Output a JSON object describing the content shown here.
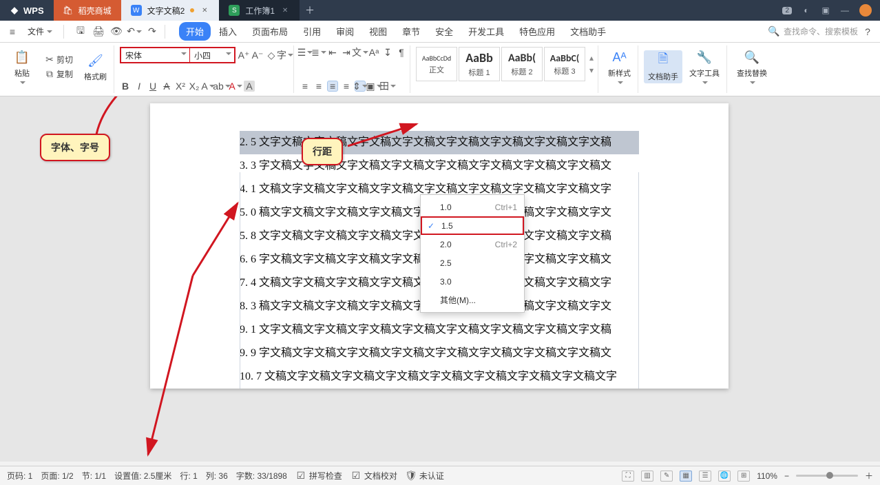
{
  "titlebar": {
    "app": "WPS",
    "tabs": [
      {
        "label": "稻壳商城",
        "kind": "store"
      },
      {
        "label": "文字文稿2",
        "kind": "doc",
        "active": true,
        "dirty": true
      },
      {
        "label": "工作簿1",
        "kind": "sheet"
      }
    ],
    "badge": "2"
  },
  "menubar": {
    "file": "文件",
    "search_icon": "🔍",
    "search_hint": "查找命令、搜索模板",
    "tabs": [
      "开始",
      "插入",
      "页面布局",
      "引用",
      "审阅",
      "视图",
      "章节",
      "安全",
      "开发工具",
      "特色应用",
      "文档助手"
    ]
  },
  "ribbon": {
    "paste": "粘贴",
    "cut": "剪切",
    "copy": "复制",
    "format_painter": "格式刷",
    "font_name": "宋体",
    "font_size": "小四",
    "styles": [
      {
        "preview": "AaBbCcDd",
        "name": "正文",
        "size": "10px"
      },
      {
        "preview": "AaBb",
        "name": "标题 1",
        "size": "18px",
        "bold": true
      },
      {
        "preview": "AaBb(",
        "name": "标题 2",
        "size": "16px",
        "bold": true
      },
      {
        "preview": "AaBbC(",
        "name": "标题 3",
        "size": "14px",
        "bold": true
      }
    ],
    "new_style": "新样式",
    "doc_helper": "文档助手",
    "text_tools": "文字工具",
    "find_replace": "查找替换"
  },
  "line_spacing_menu": {
    "items": [
      {
        "label": "1.0",
        "shortcut": "Ctrl+1"
      },
      {
        "label": "1.5",
        "selected": true
      },
      {
        "label": "2.0",
        "shortcut": "Ctrl+2"
      },
      {
        "label": "2.5"
      },
      {
        "label": "3.0"
      },
      {
        "label": "其他(M)..."
      }
    ]
  },
  "callouts": {
    "font": "字体、字号",
    "linespacing": "行距"
  },
  "document_lines": [
    "2. 5 文字文稿文字文稿文字文稿文字文稿文字文稿文字文稿文字文稿文字文稿",
    "3. 3 字文稿文字文稿文字文稿文字文稿文字文稿文字文稿文字文稿文字文稿文",
    "4. 1 文稿文字文稿文字文稿文字文稿文字文稿文字文稿文字文稿文字文稿文字",
    "5. 0 稿文字文稿文字文稿文字文稿文字文稿文字文稿文字文稿文字文稿文字文",
    "5. 8 文字文稿文字文稿文字文稿文字文稿文字文稿文字文稿文字文稿文字文稿",
    "6. 6 字文稿文字文稿文字文稿文字文稿文字文稿文字文稿文字文稿文字文稿文",
    "7. 4 文稿文字文稿文字文稿文字文稿文字文稿文字文稿文字文稿文字文稿文字",
    "8. 3 稿文字文稿文字文稿文字文稿文字文稿文字文稿文字文稿文字文稿文字文",
    "9. 1 文字文稿文字文稿文字文稿文字文稿文字文稿文字文稿文字文稿文字文稿",
    "9. 9 字文稿文字文稿文字文稿文字文稿文字文稿文字文稿文字文稿文字文稿文",
    "10. 7 文稿文字文稿文字文稿文字文稿文字文稿文字文稿文字文稿文字文稿文字"
  ],
  "statusbar": {
    "page_no": "页码: 1",
    "page": "页面: 1/2",
    "section": "节: 1/1",
    "setting": "设置值: 2.5厘米",
    "row": "行: 1",
    "col": "列: 36",
    "chars": "字数: 33/1898",
    "spell": "拼写检查",
    "proof": "文档校对",
    "auth": "未认证",
    "zoom": "110%"
  }
}
